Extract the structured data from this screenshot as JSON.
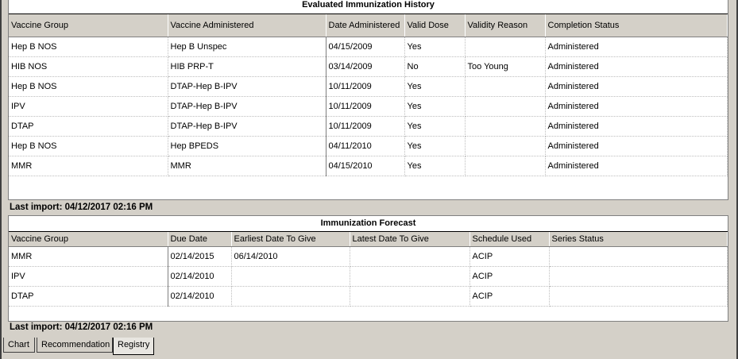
{
  "history": {
    "title": "Evaluated Immunization History",
    "columns": [
      "Vaccine Group",
      "Vaccine Administered",
      "Date Administered",
      "Valid Dose",
      "Validity Reason",
      "Completion Status"
    ],
    "rows": [
      [
        "Hep B NOS",
        "Hep B Unspec",
        "04/15/2009",
        "Yes",
        "",
        "Administered"
      ],
      [
        "HIB NOS",
        "HIB PRP-T",
        "03/14/2009",
        "No",
        "Too Young",
        "Administered"
      ],
      [
        "Hep B NOS",
        "DTAP-Hep B-IPV",
        "10/11/2009",
        "Yes",
        "",
        "Administered"
      ],
      [
        "IPV",
        "DTAP-Hep B-IPV",
        "10/11/2009",
        "Yes",
        "",
        "Administered"
      ],
      [
        "DTAP",
        "DTAP-Hep B-IPV",
        "10/11/2009",
        "Yes",
        "",
        "Administered"
      ],
      [
        "Hep B NOS",
        "Hep BPEDS",
        "04/11/2010",
        "Yes",
        "",
        "Administered"
      ],
      [
        "MMR",
        "MMR",
        "04/15/2010",
        "Yes",
        "",
        "Administered"
      ]
    ],
    "last_import": "Last import:  04/12/2017 02:16 PM"
  },
  "forecast": {
    "title": "Immunization Forecast",
    "columns": [
      "Vaccine Group",
      "Due Date",
      "Earliest Date To Give",
      "Latest Date To Give",
      "Schedule Used",
      "Series Status"
    ],
    "rows": [
      [
        "MMR",
        "02/14/2015",
        "06/14/2010",
        "",
        "ACIP",
        ""
      ],
      [
        "IPV",
        "02/14/2010",
        "",
        "",
        "ACIP",
        ""
      ],
      [
        "DTAP",
        "02/14/2010",
        "",
        "",
        "ACIP",
        ""
      ]
    ],
    "last_import": "Last import:  04/12/2017 02:16 PM"
  },
  "tabs": [
    {
      "label": "Chart",
      "active": false
    },
    {
      "label": "Recommendation",
      "active": false
    },
    {
      "label": "Registry",
      "active": true
    }
  ]
}
